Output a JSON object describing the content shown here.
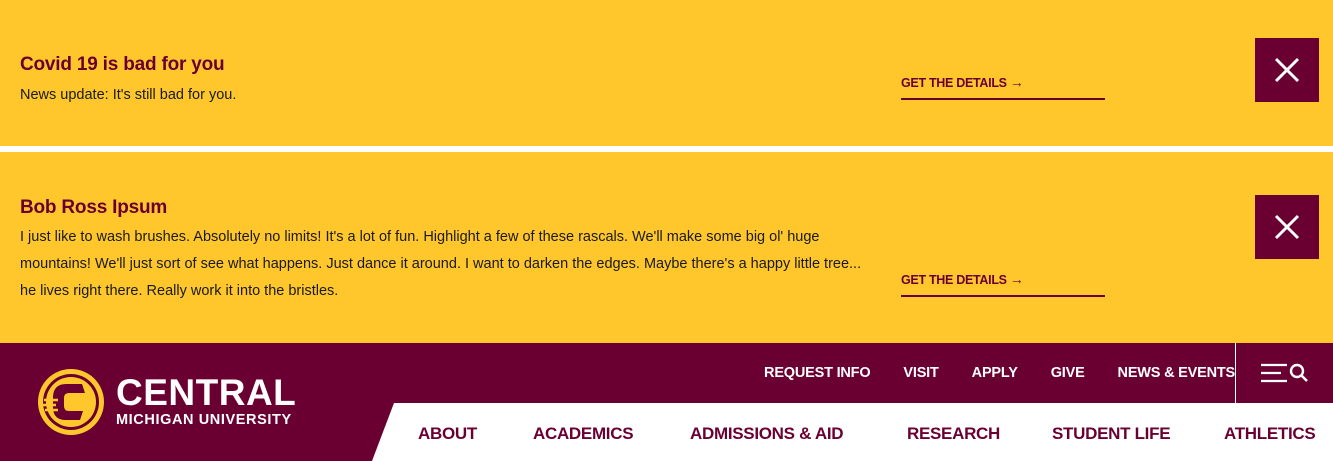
{
  "alerts": [
    {
      "title": "Covid 19 is bad for you",
      "body": "News update: It's still bad for you.",
      "link_label": "GET THE DETAILS"
    },
    {
      "title": "Bob Ross Ipsum",
      "body": "I just like to wash brushes. Absolutely no limits! It's a lot of fun. Highlight a few of these rascals. We'll make some big ol' huge mountains! We'll just sort of see what happens. Just dance it around. I want to darken the edges. Maybe there's a happy little tree... he lives right there. Really work it into the bristles.",
      "link_label": "GET THE DETAILS"
    }
  ],
  "header": {
    "logo_main": "CENTRAL",
    "logo_sub": "MICHIGAN UNIVERSITY",
    "utility_nav": [
      "REQUEST INFO",
      "VISIT",
      "APPLY",
      "GIVE",
      "NEWS & EVENTS"
    ],
    "main_nav": [
      "ABOUT",
      "ACADEMICS",
      "ADMISSIONS & AID",
      "RESEARCH",
      "STUDENT LIFE",
      "ATHLETICS"
    ]
  },
  "colors": {
    "maroon": "#6a0032",
    "gold": "#ffc72c",
    "white": "#ffffff"
  },
  "icons": {
    "close": "close-icon",
    "arrow": "arrow-right-icon",
    "menu": "hamburger-menu-icon",
    "search": "search-icon",
    "logo": "action-c-logo-icon"
  }
}
